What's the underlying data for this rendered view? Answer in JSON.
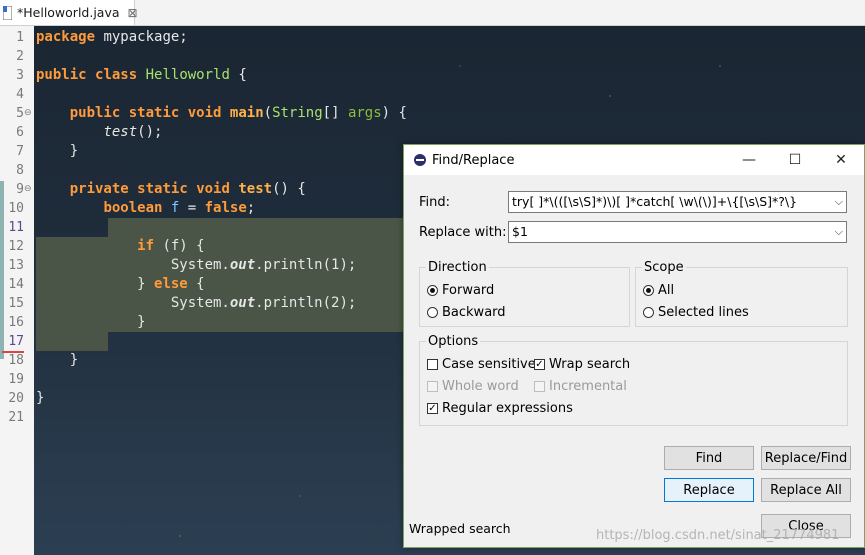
{
  "tab": {
    "title": "*Helloworld.java",
    "close": "⊠"
  },
  "editor": {
    "line_numbers": [
      "1",
      "2",
      "3",
      "4",
      "5",
      "6",
      "7",
      "8",
      "9",
      "10",
      "11",
      "12",
      "13",
      "14",
      "15",
      "16",
      "17",
      "18",
      "19",
      "20",
      "21"
    ],
    "lines": {
      "l1_kw": "package",
      "l1_rest": " mypackage;",
      "l3_kw1": "public",
      "l3_kw2": "class",
      "l3_cls": "Helloworld",
      "l3_rest": " {",
      "l5_kw1": "public",
      "l5_kw2": "static",
      "l5_kw3": "void",
      "l5_mth": "main",
      "l5_p1": "(",
      "l5_cls": "String",
      "l5_p2": "[] ",
      "l5_arg": "args",
      "l5_p3": ") {",
      "l6_mth": "test",
      "l6_rest": "();",
      "l7": "}",
      "l9_kw1": "private",
      "l9_kw2": "static",
      "l9_kw3": "void",
      "l9_mth": "test",
      "l9_rest": "() {",
      "l10_kw": "boolean",
      "l10_var": "f",
      "l10_eq": " = ",
      "l10_kw2": "false",
      "l10_end": ";",
      "l12_kw": "if",
      "l12_rest": " (f) {",
      "l13_a": "System.",
      "l13_fld": "out",
      "l13_b": ".println(1);",
      "l14_a": "} ",
      "l14_kw": "else",
      "l14_b": " {",
      "l15_a": "System.",
      "l15_fld": "out",
      "l15_b": ".println(2);",
      "l16": "}",
      "l18": "}",
      "l20": "}"
    }
  },
  "dialog": {
    "title": "Find/Replace",
    "minimize": "—",
    "maximize": "☐",
    "close": "✕",
    "find_label": "Find:",
    "find_value": "try[ ]*\\(([\\s\\S]*)\\)[ ]*catch[ \\w\\(\\)]+\\{[\\s\\S]*?\\}",
    "replace_label": "Replace with:",
    "replace_value": "$1",
    "direction_title": "Direction",
    "forward": "Forward",
    "backward": "Backward",
    "scope_title": "Scope",
    "all": "All",
    "selected_lines": "Selected lines",
    "options_title": "Options",
    "case_sensitive": "Case sensitive",
    "wrap_search": "Wrap search",
    "whole_word": "Whole word",
    "incremental": "Incremental",
    "regular_expressions": "Regular expressions",
    "check_mark": "✓",
    "btn_find": "Find",
    "btn_replace_find": "Replace/Find",
    "btn_replace": "Replace",
    "btn_replace_all": "Replace All",
    "btn_close": "Close",
    "status": "Wrapped search"
  },
  "watermark": "https://blog.csdn.net/sinat_21774981",
  "colors": {
    "keyword": "#ff9b3a",
    "class": "#a7e26c",
    "selection": "#4a5547",
    "dialog_border": "#7fa35f"
  }
}
